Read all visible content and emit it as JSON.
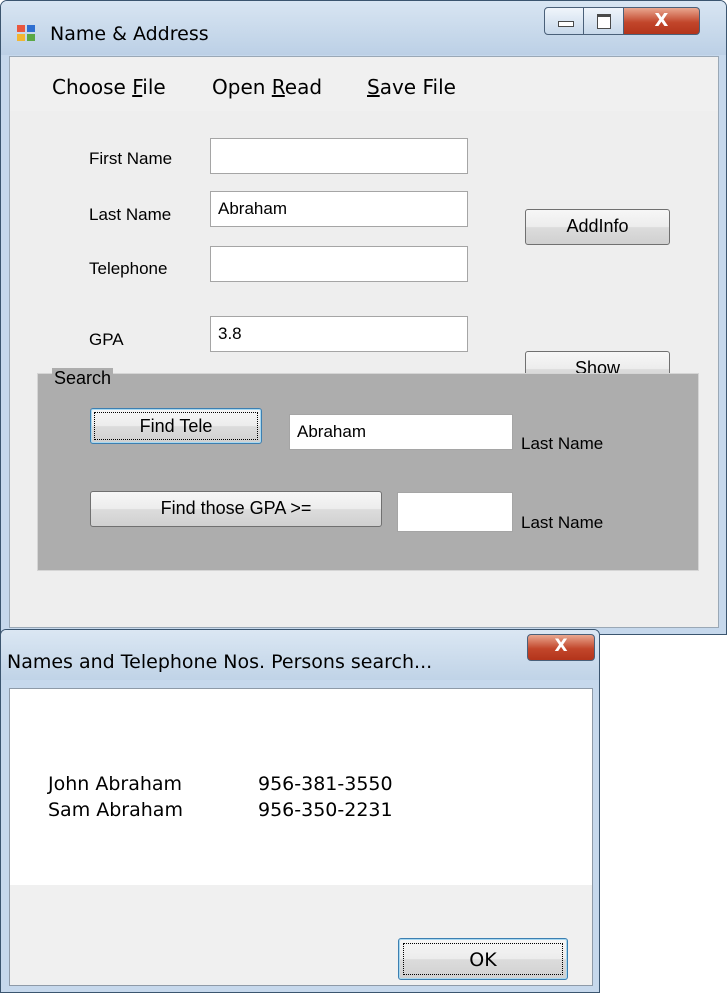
{
  "main_window": {
    "title": "Name & Address",
    "controls": {
      "minimize": "minimize-icon",
      "maximize": "maximize-icon",
      "close_glyph": "X"
    },
    "menu": [
      {
        "before": "Choose ",
        "underline": "F",
        "after": "ile"
      },
      {
        "before": "Open ",
        "underline": "R",
        "after": "ead"
      },
      {
        "before": "",
        "underline": "S",
        "after": "ave File"
      }
    ],
    "form": {
      "first_name_label": "First Name",
      "first_name_value": "",
      "last_name_label": "Last Name",
      "last_name_value": "Abraham",
      "telephone_label": "Telephone",
      "telephone_value": "",
      "gpa_label": "GPA",
      "gpa_value": "3.8",
      "addinfo_label": "AddInfo",
      "show_label": "Show"
    },
    "search": {
      "legend": "Search",
      "find_tele_label": "Find Tele",
      "find_tele_value": "Abraham",
      "find_tele_caption": "Last Name",
      "find_gpa_label": "Find those GPA >=",
      "find_gpa_value": "",
      "find_gpa_caption": "Last Name"
    }
  },
  "dialog": {
    "title": "Names and Telephone Nos. Persons search...",
    "close_glyph": "X",
    "results": [
      {
        "name": "John Abraham",
        "phone": "956-381-3550"
      },
      {
        "name": "Sam Abraham",
        "phone": "956-350-2231"
      }
    ],
    "ok_label": "OK"
  },
  "colors": {
    "title_bar": "#c6d8ec",
    "close_button": "#c2462b",
    "search_group": "#adadad"
  }
}
